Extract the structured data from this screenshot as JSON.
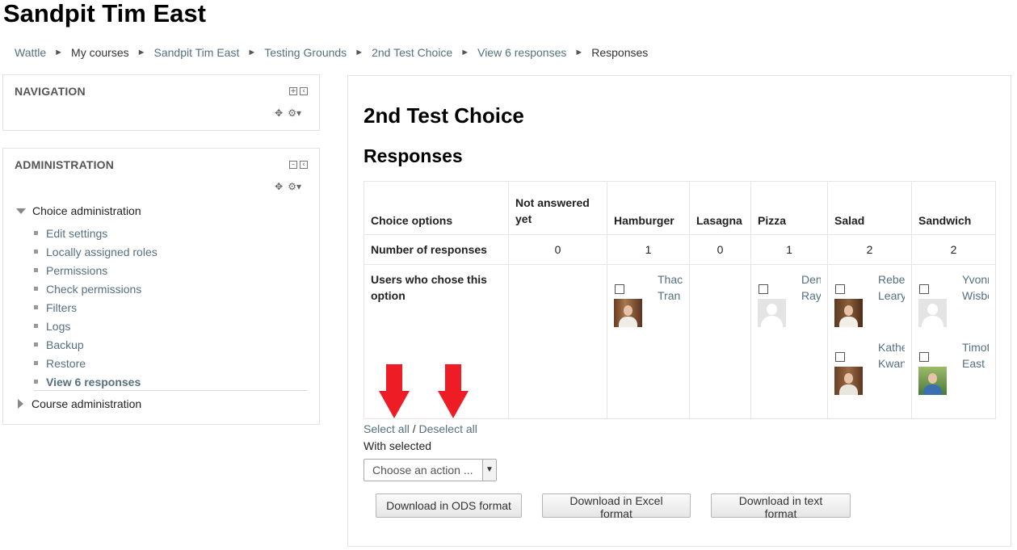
{
  "page": {
    "heading": "Sandpit Tim East"
  },
  "breadcrumb": [
    {
      "label": "Wattle",
      "link": true
    },
    {
      "label": "My courses",
      "link": false
    },
    {
      "label": "Sandpit Tim East",
      "link": true
    },
    {
      "label": "Testing Grounds",
      "link": true
    },
    {
      "label": "2nd Test Choice",
      "link": true
    },
    {
      "label": "View 6 responses",
      "link": true
    },
    {
      "label": "Responses",
      "link": false
    }
  ],
  "breadcrumb_separator": "►",
  "navigation_block": {
    "title": "NAVIGATION"
  },
  "administration_block": {
    "title": "ADMINISTRATION",
    "choice_admin_label": "Choice administration",
    "items": [
      {
        "label": "Edit settings"
      },
      {
        "label": "Locally assigned roles"
      },
      {
        "label": "Permissions"
      },
      {
        "label": "Check permissions"
      },
      {
        "label": "Filters"
      },
      {
        "label": "Logs"
      },
      {
        "label": "Backup"
      },
      {
        "label": "Restore"
      },
      {
        "label": "View 6 responses",
        "active": true
      }
    ],
    "course_admin_label": "Course administration"
  },
  "main": {
    "title": "2nd Test Choice",
    "subtitle": "Responses",
    "table": {
      "row_label_options": "Choice options",
      "row_label_counts": "Number of responses",
      "row_label_users": "Users who chose this option",
      "columns": [
        {
          "header": "Not answered yet",
          "count": "0"
        },
        {
          "header": "Hamburger",
          "count": "1"
        },
        {
          "header": "Lasagna",
          "count": "0"
        },
        {
          "header": "Pizza",
          "count": "1"
        },
        {
          "header": "Salad",
          "count": "2"
        },
        {
          "header": "Sandwich",
          "count": "2"
        }
      ],
      "users": {
        "hamburger": [
          {
            "name_line1": "Thac",
            "name_line2": "Tran"
          }
        ],
        "pizza": [
          {
            "name_line1": "Den",
            "name_line2": "Ray"
          }
        ],
        "salad": [
          {
            "name_line1": "Rebe",
            "name_line2": "Leary"
          },
          {
            "name_line1": "Kathe",
            "name_line2": "Kwan"
          }
        ],
        "sandwich": [
          {
            "name_line1": "Yvonr",
            "name_line2": "Wisbe"
          },
          {
            "name_line1": "Timot",
            "name_line2": "East"
          }
        ]
      }
    },
    "select_all": "Select all",
    "slash": "/",
    "deselect_all": "Deselect all",
    "with_selected": "With selected",
    "action_select_value": "Choose an action ...",
    "buttons": {
      "ods": "Download in ODS format",
      "excel": "Download in Excel format",
      "text": "Download in text format"
    }
  },
  "colors": {
    "link": "#55707f",
    "annotation_arrow": "#ee1c25"
  }
}
